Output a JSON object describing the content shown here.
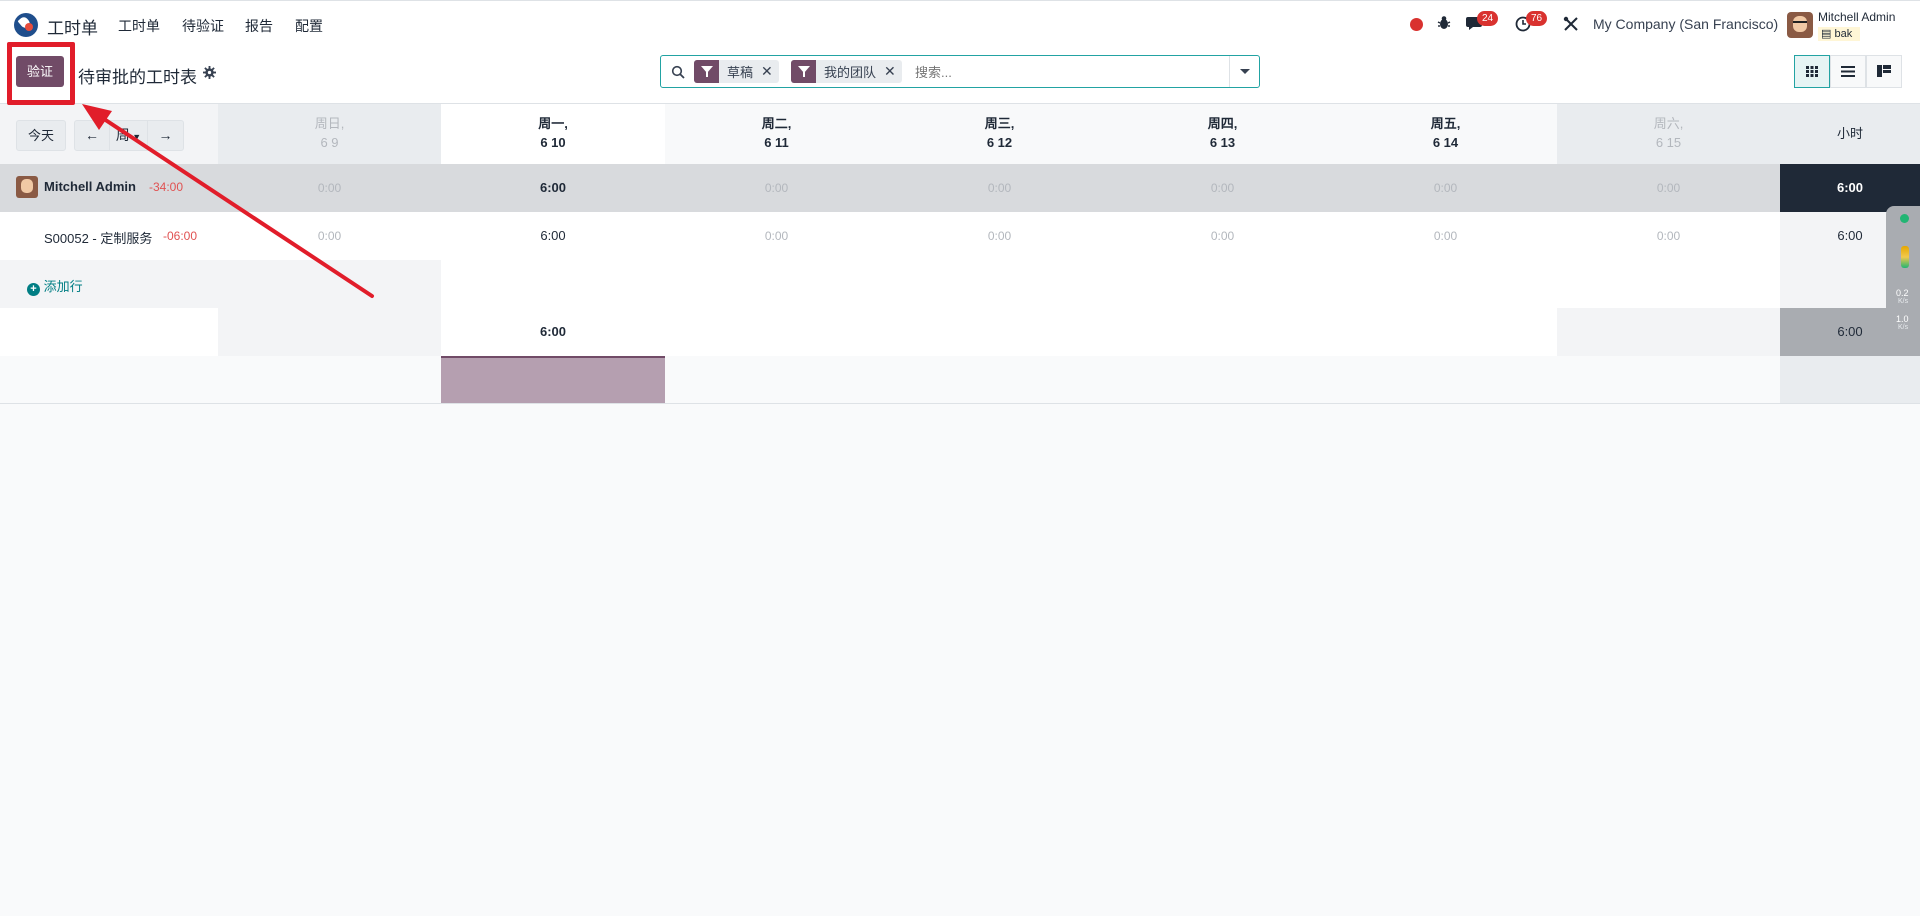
{
  "navbar": {
    "app_name": "工时单",
    "menu": [
      "工时单",
      "待验证",
      "报告",
      "配置"
    ],
    "chat_badge": "24",
    "activity_badge": "76",
    "company": "My Company (San Francisco)",
    "user_name": "Mitchell Admin",
    "db_name": "bak",
    "icons": [
      "app-logo-icon",
      "record-icon",
      "bug-icon",
      "chat-icon",
      "clock-icon",
      "tools-icon",
      "avatar"
    ]
  },
  "control_panel": {
    "validate_label": "验证",
    "title": "待审批的工时表",
    "search": {
      "facets": [
        {
          "label": "草稿"
        },
        {
          "label": "我的团队"
        }
      ],
      "placeholder": "搜索..."
    },
    "views": [
      "grid-view",
      "list-view",
      "kanban-view"
    ]
  },
  "grid": {
    "today_label": "今天",
    "period_label": "周",
    "days": [
      {
        "weekday": "周日,",
        "date": "6 9",
        "weekend": true
      },
      {
        "weekday": "周一,",
        "date": "6 10",
        "weekend": false
      },
      {
        "weekday": "周二,",
        "date": "6 11",
        "weekend": false
      },
      {
        "weekday": "周三,",
        "date": "6 12",
        "weekend": false
      },
      {
        "weekday": "周四,",
        "date": "6 13",
        "weekend": false
      },
      {
        "weekday": "周五,",
        "date": "6 14",
        "weekend": false
      },
      {
        "weekday": "周六,",
        "date": "6 15",
        "weekend": true
      }
    ],
    "total_header": "小时",
    "employee": {
      "name": "Mitchell Admin",
      "delta": "-34:00",
      "values": [
        "0:00",
        "6:00",
        "0:00",
        "0:00",
        "0:00",
        "0:00",
        "0:00"
      ],
      "total": "6:00"
    },
    "task": {
      "name": "S00052 - 定制服务",
      "delta": "-06:00",
      "values": [
        "0:00",
        "6:00",
        "0:00",
        "0:00",
        "0:00",
        "0:00",
        "0:00"
      ],
      "total": "6:00"
    },
    "add_line_label": "添加行",
    "day_totals": [
      "",
      "6:00",
      "",
      "",
      "",
      "",
      ""
    ],
    "grand_total": "6:00",
    "widget": {
      "upload": "0.2",
      "download": "1.0",
      "unit": "K/s"
    }
  },
  "colors": {
    "primary": "#714b67",
    "accent": "#22a3a3",
    "danger": "#e11d2a",
    "dark_total": "#1f2937"
  }
}
